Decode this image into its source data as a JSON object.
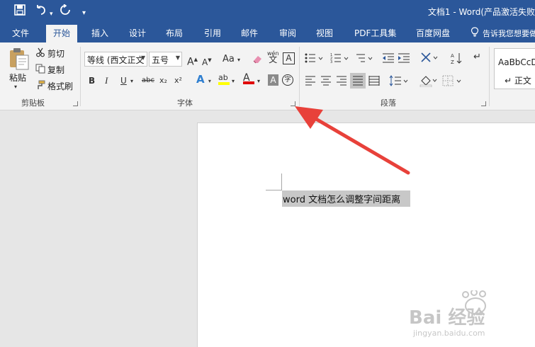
{
  "title_bar": {
    "title": "文档1 - Word(产品激活失败",
    "save_icon": "save-icon",
    "undo_icon": "undo-icon",
    "redo_icon": "redo-icon",
    "customize_icon": "customize-icon"
  },
  "tabs": [
    "文件",
    "开始",
    "插入",
    "设计",
    "布局",
    "引用",
    "邮件",
    "审阅",
    "视图",
    "PDF工具集",
    "百度网盘"
  ],
  "tell_me": "告诉我您想要做",
  "clipboard": {
    "paste": "粘贴",
    "cut": "剪切",
    "copy": "复制",
    "format_painter": "格式刷",
    "group_label": "剪贴板"
  },
  "font": {
    "font_name": "等线 (西文正文",
    "font_size": "五号",
    "group_label": "字体",
    "grow": "A",
    "shrink": "A",
    "change_case": "Aa",
    "bold": "B",
    "italic": "I",
    "underline": "U",
    "strike": "abc",
    "subscript": "x₂",
    "superscript": "x²",
    "text_effects": "A",
    "highlight": "ab",
    "font_color": "A",
    "char_shading": "A",
    "enclose": "字",
    "phonetic": "wén",
    "phonetic_base": "文",
    "border": "A"
  },
  "paragraph": {
    "group_label": "段落"
  },
  "styles": {
    "sample": "AaBbCcD",
    "name": "↵ 正文"
  },
  "document": {
    "selected_text": "word 文档怎么调整字间距离"
  },
  "watermark": {
    "brand": "Bai 经验",
    "url": "jingyan.baidu.com"
  },
  "colors": {
    "accent": "#2b579a",
    "arrow": "#e8413a",
    "highlight": "#ffff00",
    "font_color": "#e00000"
  }
}
